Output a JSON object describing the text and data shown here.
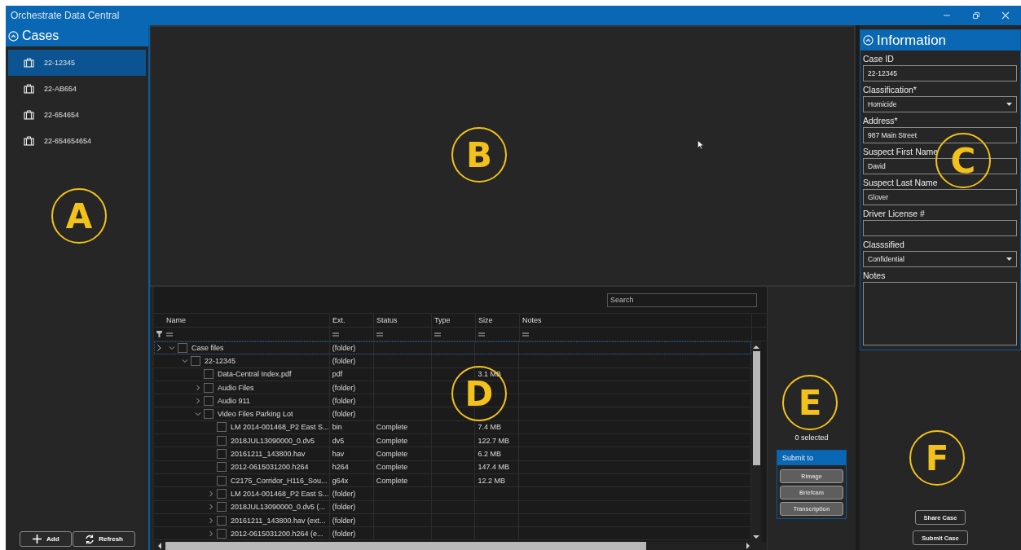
{
  "window": {
    "title": "Orchestrate Data Central"
  },
  "cases": {
    "title": "Cases",
    "callout": "A",
    "items": [
      {
        "label": "22-12345",
        "selected": true
      },
      {
        "label": "22-AB654",
        "selected": false
      },
      {
        "label": "22-654654",
        "selected": false
      },
      {
        "label": "22-654654654",
        "selected": false
      }
    ],
    "buttons": [
      {
        "label": "Add",
        "kind": "add"
      },
      {
        "label": "Refresh",
        "kind": "refresh"
      }
    ]
  },
  "viewer": {
    "callout": "B"
  },
  "files": {
    "callout": "D",
    "search": {
      "placeholder": "Search"
    },
    "columns": [
      "Name",
      "Ext.",
      "Status",
      "Type",
      "Size",
      "Notes"
    ],
    "tree": [
      {
        "name": "Case files",
        "ext": "(folder)",
        "checked": false,
        "focused": true,
        "expanded": true,
        "children": [
          {
            "name": "22-12345",
            "ext": "(folder)",
            "checked": false,
            "focused": false,
            "expanded": true,
            "children": [
              {
                "name": "Data-Central Index.pdf",
                "ext": "pdf",
                "size": "3.1 MB",
                "checked": false,
                "focused": false
              },
              {
                "name": "Audio Files",
                "ext": "(folder)",
                "checked": false,
                "focused": false,
                "expanded": false
              },
              {
                "name": "Audio  911",
                "ext": "(folder)",
                "checked": false,
                "focused": false,
                "expanded": false
              },
              {
                "name": "Video Files Parking Lot",
                "ext": "(folder)",
                "checked": false,
                "focused": false,
                "expanded": true,
                "children": [
                  {
                    "name": "LM 2014-001468_P2 East S...",
                    "ext": "bin",
                    "status": "Complete",
                    "size": "7.4 MB",
                    "checked": false,
                    "focused": false
                  },
                  {
                    "name": "2018JUL13090000_0.dv5",
                    "ext": "dv5",
                    "status": "Complete",
                    "size": "122.7 MB",
                    "checked": false,
                    "focused": false
                  },
                  {
                    "name": "20161211_143800.hav",
                    "ext": "hav",
                    "status": "Complete",
                    "size": "6.2 MB",
                    "checked": false,
                    "focused": false
                  },
                  {
                    "name": "2012-0615031200.h264",
                    "ext": "h264",
                    "status": "Complete",
                    "size": "147.4 MB",
                    "checked": false,
                    "focused": false
                  },
                  {
                    "name": "C2175_Corridor_H116_Sou...",
                    "ext": "g64x",
                    "status": "Complete",
                    "size": "12.2 MB",
                    "checked": false,
                    "focused": false
                  },
                  {
                    "name": "LM 2014-001468_P2 East S...",
                    "ext": "(folder)",
                    "checked": false,
                    "focused": false,
                    "expanded": false
                  },
                  {
                    "name": "2018JUL13090000_0.dv5 (...",
                    "ext": "(folder)",
                    "checked": false,
                    "focused": false,
                    "expanded": false
                  },
                  {
                    "name": "20161211_143800.hav (ext...",
                    "ext": "(folder)",
                    "checked": false,
                    "focused": false,
                    "expanded": false
                  },
                  {
                    "name": "2012-0615031200.h264 (e...",
                    "ext": "(folder)",
                    "checked": false,
                    "focused": false,
                    "expanded": false
                  }
                ]
              }
            ]
          }
        ]
      }
    ]
  },
  "submit": {
    "callout": "E",
    "count": "0 selected",
    "title": "Submit to",
    "buttons": [
      {
        "label": "Rimage",
        "disabled": true
      },
      {
        "label": "Briefcam",
        "disabled": true
      },
      {
        "label": "Transcription",
        "disabled": true
      }
    ]
  },
  "information": {
    "title": "Information",
    "callout": "C",
    "fields": [
      {
        "label": "Case ID",
        "kind": "text",
        "value": "22-12345"
      },
      {
        "label": "Classification*",
        "kind": "select",
        "value": "Homicide"
      },
      {
        "label": "Address*",
        "kind": "text",
        "value": "987 Main Street"
      },
      {
        "label": "Suspect First Name",
        "kind": "text",
        "value": "David"
      },
      {
        "label": "Suspect Last Name",
        "kind": "text",
        "value": "Glover"
      },
      {
        "label": "Driver License #",
        "kind": "text"
      },
      {
        "label": "Classsified",
        "kind": "select",
        "value": "Confidential"
      },
      {
        "label": "Notes",
        "kind": "textarea"
      }
    ]
  },
  "actions": {
    "callout": "F",
    "buttons": [
      "Share Case",
      "Submit Case"
    ]
  }
}
